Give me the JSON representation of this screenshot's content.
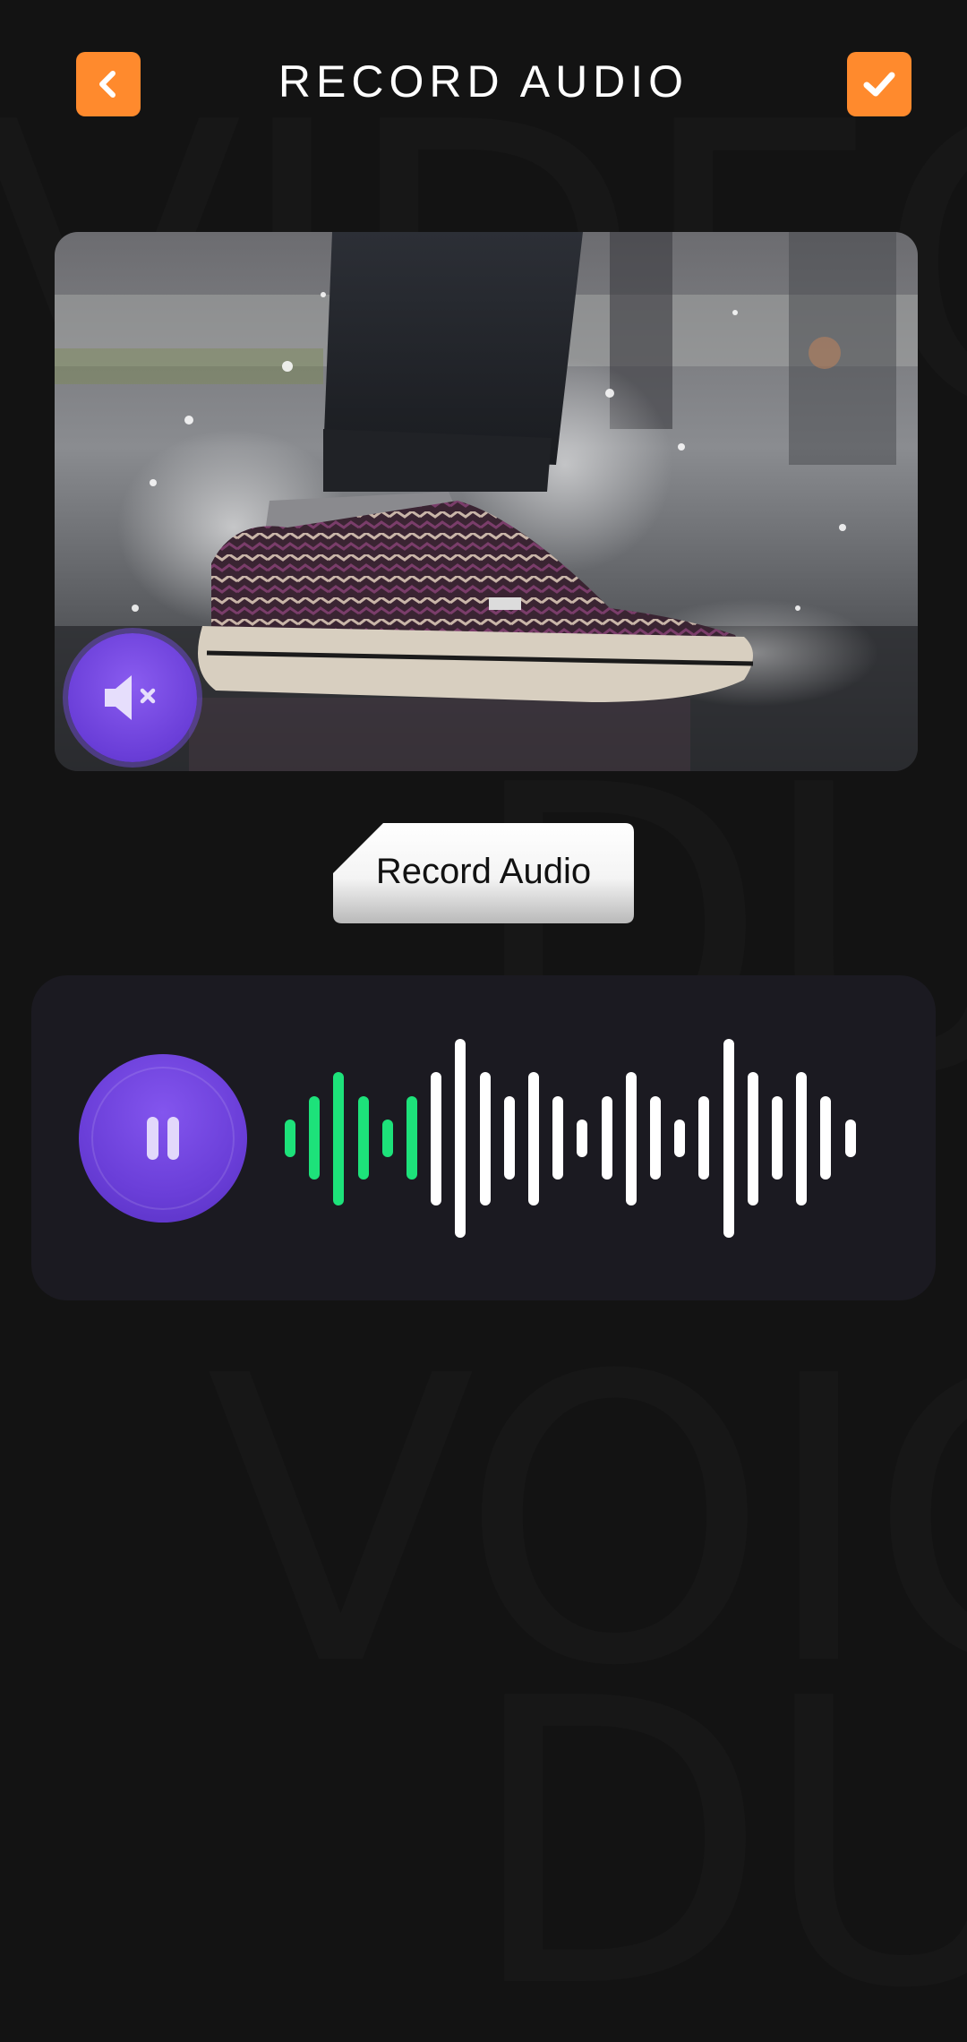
{
  "header": {
    "title": "RECORD AUDIO",
    "back_icon": "chevron-left-icon",
    "done_icon": "check-icon"
  },
  "preview": {
    "image": "sneaker splashing in puddle",
    "mute_icon": "speaker-mute-icon"
  },
  "record_tab": {
    "label": "Record Audio"
  },
  "player": {
    "pause_icon": "pause-icon",
    "played_color": "#1de27a",
    "unplayed_color": "#ffffff",
    "waveform": [
      0.19,
      0.42,
      0.67,
      0.42,
      0.19,
      0.42,
      0.67,
      1.0,
      0.67,
      0.42,
      0.67,
      0.42,
      0.19,
      0.42,
      0.67,
      0.42,
      0.19,
      0.42,
      1.0,
      0.67,
      0.42,
      0.67,
      0.42,
      0.19
    ],
    "played_bars": 6
  },
  "colors": {
    "accent": "#ff8a2d",
    "purple": "#6a3ed8",
    "background": "#131313",
    "panel": "#1b1a21"
  }
}
